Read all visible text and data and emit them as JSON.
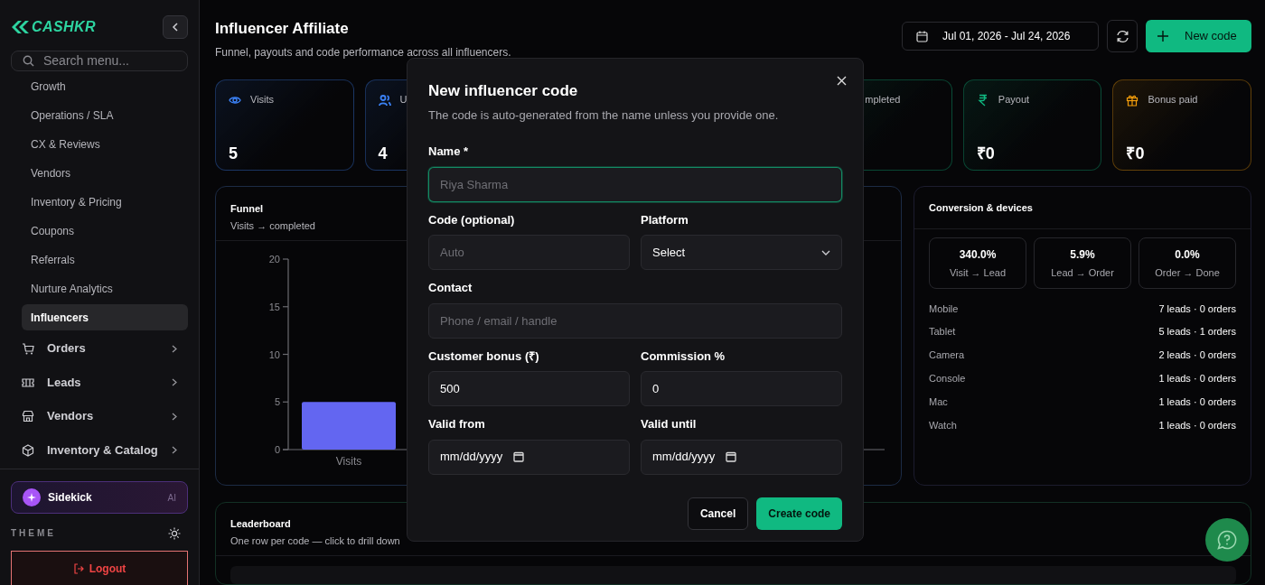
{
  "sidebar": {
    "logo": "CASHKR",
    "search": {
      "placeholder": "Search menu..."
    },
    "items": [
      {
        "label": "Growth",
        "kind": "sub",
        "selected": false
      },
      {
        "label": "Operations / SLA",
        "kind": "sub",
        "selected": false
      },
      {
        "label": "CX & Reviews",
        "kind": "sub",
        "selected": false
      },
      {
        "label": "Vendors",
        "kind": "sub",
        "selected": false
      },
      {
        "label": "Inventory & Pricing",
        "kind": "sub",
        "selected": false
      },
      {
        "label": "Coupons",
        "kind": "sub",
        "selected": false
      },
      {
        "label": "Referrals",
        "kind": "sub",
        "selected": false
      },
      {
        "label": "Nurture Analytics",
        "kind": "sub",
        "selected": false
      },
      {
        "label": "Influencers",
        "kind": "sub",
        "selected": true
      },
      {
        "label": "Orders",
        "kind": "cart",
        "selected": false
      },
      {
        "label": "Leads",
        "kind": "ticket",
        "selected": false
      },
      {
        "label": "Vendors",
        "kind": "store",
        "selected": false
      },
      {
        "label": "Inventory & Catalog",
        "kind": "box",
        "selected": false
      }
    ],
    "sidekick": {
      "label": "Sidekick",
      "badge": "AI"
    },
    "theme_label": "THEME",
    "logout": "Logout"
  },
  "header": {
    "title": "Influencer Affiliate",
    "subtitle": "Funnel, payouts and code performance across all influencers.",
    "date_range": "Jul 01, 2026 - Jul 24, 2026",
    "new_button": "New code"
  },
  "stats": [
    {
      "label": "Visits",
      "value": "5",
      "kind": "eye",
      "color": "#3b82f6"
    },
    {
      "label": "U",
      "value": "4",
      "kind": "users",
      "color": "#3b82f6"
    },
    {
      "label": "mpleted",
      "kind": "partial"
    },
    {
      "label": "Payout",
      "value": "₹0",
      "kind": "rupee",
      "color": "#10b981"
    },
    {
      "label": "Bonus paid",
      "value": "₹0",
      "kind": "gift",
      "color": "#f59e0b"
    }
  ],
  "funnel": {
    "title": "Funnel",
    "subtitle": "Visits → completed",
    "chart_data": {
      "type": "bar",
      "categories": [
        "Visits"
      ],
      "values": [
        5
      ],
      "ylim": [
        0,
        20
      ],
      "yticks": [
        0,
        5,
        10,
        15,
        20
      ]
    }
  },
  "conversion": {
    "title": "Conversion & devices",
    "rates": [
      {
        "value": "340.0%",
        "label": "Visit → Lead"
      },
      {
        "value": "5.9%",
        "label": "Lead → Order"
      },
      {
        "value": "0.0%",
        "label": "Order → Done"
      }
    ],
    "devices": [
      {
        "name": "Mobile",
        "stats": "7 leads · 0 orders"
      },
      {
        "name": "Tablet",
        "stats": "5 leads · 1 orders"
      },
      {
        "name": "Camera",
        "stats": "2 leads · 0 orders"
      },
      {
        "name": "Console",
        "stats": "1 leads · 0 orders"
      },
      {
        "name": "Mac",
        "stats": "1 leads · 0 orders"
      },
      {
        "name": "Watch",
        "stats": "1 leads · 0 orders"
      }
    ]
  },
  "leaderboard": {
    "title": "Leaderboard",
    "subtitle": "One row per code — click to drill down"
  },
  "modal": {
    "title": "New influencer code",
    "subtitle": "The code is auto-generated from the name unless you provide one.",
    "rows": [
      [
        {
          "label": "Name *",
          "kind": "text",
          "placeholder": "Riya Sharma",
          "focused": true
        }
      ],
      [
        {
          "label": "Code (optional)",
          "kind": "text",
          "placeholder": "Auto",
          "focused": false
        },
        {
          "label": "Platform",
          "kind": "select",
          "value": "Select",
          "focused": false
        }
      ],
      [
        {
          "label": "Contact",
          "kind": "text",
          "placeholder": "Phone / email / handle",
          "focused": false
        }
      ],
      [
        {
          "label": "Customer bonus (₹)",
          "kind": "text",
          "value": "500",
          "focused": false
        },
        {
          "label": "Commission %",
          "kind": "text",
          "value": "0",
          "focused": false
        }
      ],
      [
        {
          "label": "Valid from",
          "kind": "date",
          "placeholder": "mm/dd/yyyy",
          "focused": false
        },
        {
          "label": "Valid until",
          "kind": "date",
          "placeholder": "mm/dd/yyyy",
          "focused": false
        }
      ]
    ],
    "cancel": "Cancel",
    "submit": "Create code"
  }
}
